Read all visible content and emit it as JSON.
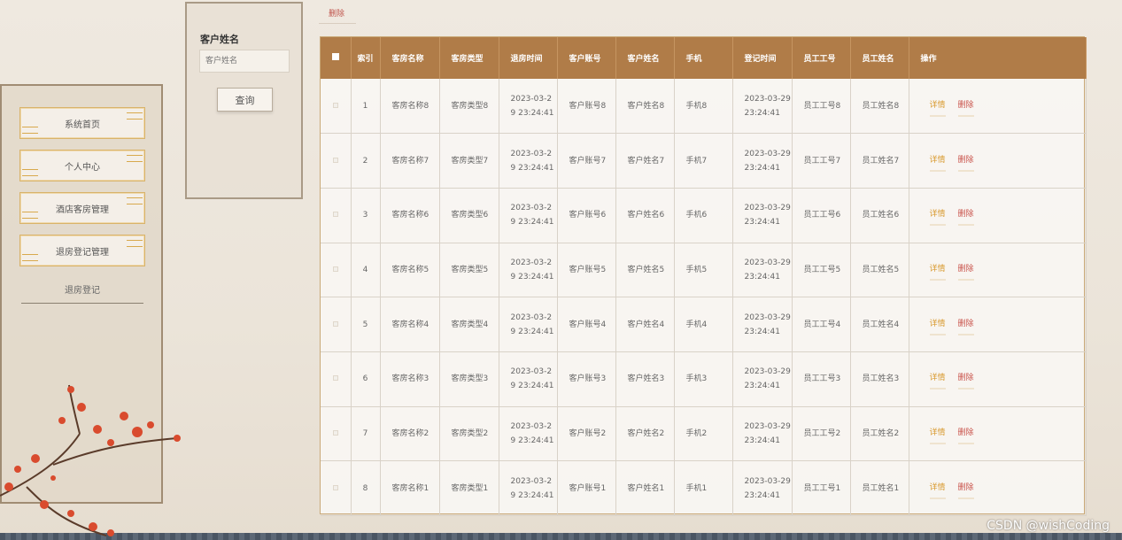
{
  "sidebar": {
    "items": [
      {
        "label": "系统首页"
      },
      {
        "label": "个人中心"
      },
      {
        "label": "酒店客房管理"
      },
      {
        "label": "退房登记管理"
      }
    ],
    "submenu": "退房登记"
  },
  "search": {
    "label": "客户姓名",
    "placeholder": "客户姓名",
    "button": "查询"
  },
  "toolbar": {
    "delete_label": "删除"
  },
  "table": {
    "headers": [
      "索引",
      "客房名称",
      "客房类型",
      "退房时间",
      "客户账号",
      "客户姓名",
      "手机",
      "登记时间",
      "员工工号",
      "员工姓名",
      "操作"
    ],
    "rows": [
      {
        "index": "1",
        "room_name": "客房名称8",
        "room_type": "客房类型8",
        "checkout_time": "2023-03-29 23:24:41",
        "account": "客户账号8",
        "customer": "客户姓名8",
        "phone": "手机8",
        "register_time": "2023-03-29 23:24:41",
        "emp_id": "员工工号8",
        "emp_name": "员工姓名8"
      },
      {
        "index": "2",
        "room_name": "客房名称7",
        "room_type": "客房类型7",
        "checkout_time": "2023-03-29 23:24:41",
        "account": "客户账号7",
        "customer": "客户姓名7",
        "phone": "手机7",
        "register_time": "2023-03-29 23:24:41",
        "emp_id": "员工工号7",
        "emp_name": "员工姓名7"
      },
      {
        "index": "3",
        "room_name": "客房名称6",
        "room_type": "客房类型6",
        "checkout_time": "2023-03-29 23:24:41",
        "account": "客户账号6",
        "customer": "客户姓名6",
        "phone": "手机6",
        "register_time": "2023-03-29 23:24:41",
        "emp_id": "员工工号6",
        "emp_name": "员工姓名6"
      },
      {
        "index": "4",
        "room_name": "客房名称5",
        "room_type": "客房类型5",
        "checkout_time": "2023-03-29 23:24:41",
        "account": "客户账号5",
        "customer": "客户姓名5",
        "phone": "手机5",
        "register_time": "2023-03-29 23:24:41",
        "emp_id": "员工工号5",
        "emp_name": "员工姓名5"
      },
      {
        "index": "5",
        "room_name": "客房名称4",
        "room_type": "客房类型4",
        "checkout_time": "2023-03-29 23:24:41",
        "account": "客户账号4",
        "customer": "客户姓名4",
        "phone": "手机4",
        "register_time": "2023-03-29 23:24:41",
        "emp_id": "员工工号4",
        "emp_name": "员工姓名4"
      },
      {
        "index": "6",
        "room_name": "客房名称3",
        "room_type": "客房类型3",
        "checkout_time": "2023-03-29 23:24:41",
        "account": "客户账号3",
        "customer": "客户姓名3",
        "phone": "手机3",
        "register_time": "2023-03-29 23:24:41",
        "emp_id": "员工工号3",
        "emp_name": "员工姓名3"
      },
      {
        "index": "7",
        "room_name": "客房名称2",
        "room_type": "客房类型2",
        "checkout_time": "2023-03-29 23:24:41",
        "account": "客户账号2",
        "customer": "客户姓名2",
        "phone": "手机2",
        "register_time": "2023-03-29 23:24:41",
        "emp_id": "员工工号2",
        "emp_name": "员工姓名2"
      },
      {
        "index": "8",
        "room_name": "客房名称1",
        "room_type": "客房类型1",
        "checkout_time": "2023-03-29 23:24:41",
        "account": "客户账号1",
        "customer": "客户姓名1",
        "phone": "手机1",
        "register_time": "2023-03-29 23:24:41",
        "emp_id": "员工工号1",
        "emp_name": "员工姓名1"
      }
    ],
    "actions": {
      "detail": "详情",
      "delete": "删除"
    }
  },
  "watermark": "CSDN @wishCoding",
  "colors": {
    "header_bg": "#b07c48",
    "detail": "#d99a2f",
    "delete": "#c9534b",
    "menu_border": "#d9b36a"
  }
}
